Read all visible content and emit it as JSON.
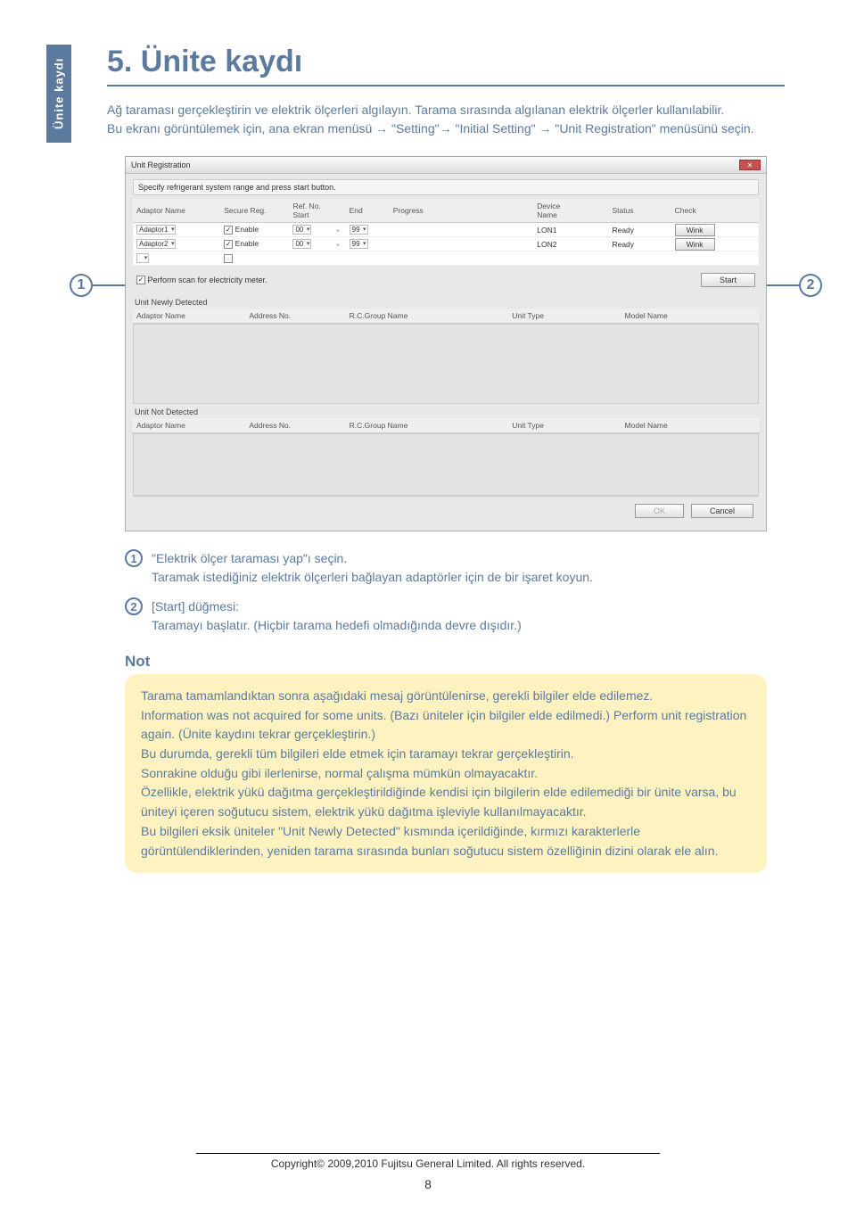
{
  "sideTab": "Ünite kaydı",
  "title": "5.  Ünite kaydı",
  "intro": "Ağ taraması gerçekleştirin ve elektrik ölçerleri algılayın. Tarama sırasında algılanan elektrik ölçerler kullanılabilir.\nBu ekranı görüntülemek için, ana ekran menüsü → \"Setting\"→ \"Initial Setting\" → \"Unit Registration\" menüsünü seçin.",
  "dialog": {
    "title": "Unit Registration",
    "hint": "Specify refrigerant system range and press start button.",
    "topHeaders": [
      "Adaptor Name",
      "Secure Reg.",
      "Ref. No.\nStart",
      "",
      "End",
      "Progress",
      "Device\nName",
      "Status",
      "Check"
    ],
    "rows": [
      {
        "adaptor": "Adaptor1",
        "secure": "Enable",
        "start": "00",
        "end": "99",
        "device": "LON1",
        "status": "Ready",
        "check": "Wink"
      },
      {
        "adaptor": "Adaptor2",
        "secure": "Enable",
        "start": "00",
        "end": "99",
        "device": "LON2",
        "status": "Ready",
        "check": "Wink"
      }
    ],
    "scanLabel": "Perform scan for electricity meter.",
    "startBtn": "Start",
    "newly": "Unit Newly Detected",
    "notDet": "Unit Not Detected",
    "cols2": [
      "Adaptor Name",
      "Address No.",
      "R.C.Group Name",
      "Unit Type",
      "Model Name"
    ],
    "ok": "OK",
    "cancel": "Cancel"
  },
  "callouts": {
    "c1": "1",
    "c2": "2"
  },
  "legend1": {
    "num": "1",
    "text": "\"Elektrik ölçer taraması yap\"ı seçin.\nTaramak istediğiniz elektrik ölçerleri bağlayan adaptörler için de bir işaret koyun."
  },
  "legend2": {
    "num": "2",
    "text": "[Start] düğmesi:\nTaramayı başlatır. (Hiçbir tarama hedefi olmadığında devre dışıdır.)"
  },
  "noteTitle": "Not",
  "noteBody": "Tarama tamamlandıktan sonra aşağıdaki mesaj görüntülenirse, gerekli bilgiler elde edilemez.\nInformation was not acquired for some units. (Bazı üniteler için bilgiler elde edilmedi.) Perform unit registration again. (Ünite kaydını tekrar gerçekleştirin.)\nBu durumda, gerekli tüm bilgileri elde etmek için taramayı tekrar gerçekleştirin.\nSonrakine olduğu gibi ilerlenirse, normal çalışma mümkün olmayacaktır.\nÖzellikle, elektrik yükü dağıtma gerçekleştirildiğinde kendisi için bilgilerin elde edilemediği bir ünite varsa, bu üniteyi içeren soğutucu sistem, elektrik yükü dağıtma işleviyle kullanılmayacaktır.\nBu bilgileri eksik üniteler \"Unit Newly Detected\" kısmında içerildiğinde, kırmızı karakterlerle görüntülendiklerinden, yeniden tarama sırasında bunları soğutucu sistem özelliğinin dizini olarak ele alın.",
  "copyright": "Copyright© 2009,2010 Fujitsu General Limited. All rights reserved.",
  "pageNum": "8"
}
